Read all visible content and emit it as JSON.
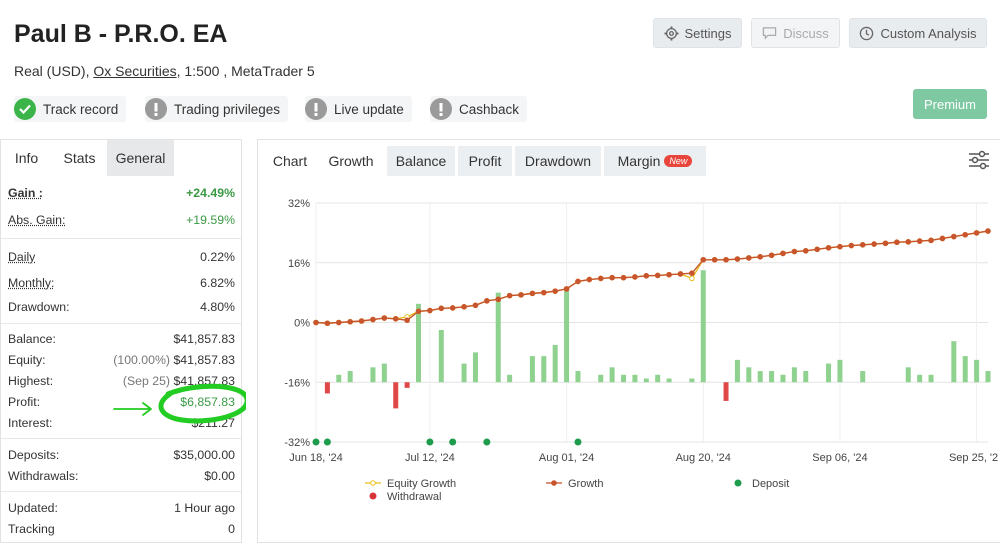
{
  "header": {
    "title": "Paul B - P.R.O. EA",
    "account_type": "Real (USD), ",
    "broker": "Ox Securities",
    "details": ", 1:500 , MetaTrader 5",
    "buttons": {
      "settings": "Settings",
      "discuss": "Discuss",
      "custom_analysis": "Custom Analysis",
      "premium": "Premium"
    }
  },
  "badges": [
    {
      "label": "Track record",
      "status": "verified"
    },
    {
      "label": "Trading privileges",
      "status": "unverified"
    },
    {
      "label": "Live update",
      "status": "unverified"
    },
    {
      "label": "Cashback",
      "status": "unverified"
    }
  ],
  "left_tabs": [
    "Info",
    "Stats",
    "General"
  ],
  "stats": {
    "gain": {
      "label": "Gain :",
      "value": "+24.49%"
    },
    "abs_gain": {
      "label": "Abs. Gain:",
      "value": "+19.59%"
    },
    "daily": {
      "label": "Daily",
      "value": "0.22%"
    },
    "monthly": {
      "label": "Monthly:",
      "value": "6.82%"
    },
    "drawdown": {
      "label": "Drawdown:",
      "value": "4.80%"
    },
    "balance": {
      "label": "Balance:",
      "value": "$41,857.83"
    },
    "equity": {
      "label": "Equity:",
      "sub": "(100.00%)",
      "value": "$41,857.83"
    },
    "highest": {
      "label": "Highest:",
      "sub": "(Sep 25)",
      "value": "$41,857.83"
    },
    "profit": {
      "label": "Profit:",
      "value": "$6,857.83"
    },
    "interest": {
      "label": "Interest:",
      "value": "$211.27"
    },
    "deposits": {
      "label": "Deposits:",
      "value": "$35,000.00"
    },
    "withdrawals": {
      "label": "Withdrawals:",
      "value": "$0.00"
    },
    "updated": {
      "label": "Updated:",
      "value": "1 Hour ago"
    },
    "tracking": {
      "label": "Tracking",
      "value": "0"
    }
  },
  "chart_tabs": {
    "chart": "Chart",
    "growth": "Growth",
    "balance": "Balance",
    "profit": "Profit",
    "drawdown": "Drawdown",
    "margin": "Margin",
    "new_badge": "New"
  },
  "colors": {
    "growth_line": "#c8552e",
    "equity_line": "#e8c020",
    "bar_positive": "#8fd18f",
    "bar_negative": "#e04848",
    "deposit": "#1e9c4c",
    "withdrawal": "#d9333a",
    "highlight": "#22cc22"
  },
  "chart_data": {
    "type": "line",
    "y_ticks": [
      "32%",
      "16%",
      "0%",
      "-16%",
      "-32%"
    ],
    "ylim": [
      -32,
      32
    ],
    "x_ticks": [
      "Jun 18, '24",
      "Jul 12, '24",
      "Aug 01, '24",
      "Aug 20, '24",
      "Sep 06, '24",
      "Sep 25, '24"
    ],
    "x_tick_index": [
      0,
      10,
      22,
      34,
      46,
      58
    ],
    "grid": true,
    "legend": [
      "Equity Growth",
      "Growth",
      "Deposit",
      "Withdrawal"
    ],
    "legend_position": "bottom",
    "series": [
      {
        "name": "Growth",
        "values": [
          0,
          -0.2,
          0,
          0.2,
          0.4,
          0.8,
          1.2,
          1,
          0.6,
          3,
          3.2,
          3.8,
          3.9,
          4.2,
          4.6,
          5.8,
          6.2,
          7.2,
          7.4,
          7.8,
          8,
          8.4,
          9,
          11,
          11.5,
          11.8,
          12,
          12,
          12.2,
          12.5,
          12.6,
          12.8,
          13,
          13.2,
          16.8,
          16.8,
          16.8,
          17,
          17.3,
          17.6,
          18,
          18.5,
          19,
          19.2,
          19.6,
          20,
          20.3,
          20.6,
          20.8,
          21,
          21.2,
          21.5,
          21.6,
          21.8,
          22,
          22.5,
          23,
          23.5,
          24,
          24.49
        ]
      },
      {
        "name": "Equity Growth",
        "values": [
          0,
          -0.2,
          0,
          0.2,
          0.4,
          0.8,
          1.2,
          1,
          1.5,
          3,
          3.2,
          3.8,
          3.9,
          4.2,
          4.6,
          5.8,
          6.2,
          7.2,
          7.4,
          7.8,
          8,
          8.4,
          9,
          11,
          11.5,
          11.8,
          12,
          12,
          12.2,
          12.5,
          12.6,
          12.8,
          13,
          11.8,
          16.8,
          16.8,
          16.8,
          17,
          17.3,
          17.6,
          18,
          18.5,
          19,
          19.2,
          19.6,
          20,
          20.3,
          20.6,
          20.8,
          21,
          21.2,
          21.5,
          21.6,
          21.8,
          22,
          22.5,
          23,
          23.5,
          24,
          24.49
        ]
      },
      {
        "name": "Profit bars",
        "values": [
          0,
          -3,
          2,
          3,
          0,
          4,
          5,
          -7,
          -1.5,
          21,
          0,
          14,
          0,
          5,
          8,
          0,
          24,
          2,
          0,
          7,
          7,
          10,
          25,
          3,
          0,
          2,
          4,
          2,
          2,
          1,
          2,
          1,
          0,
          1,
          30,
          0,
          -5,
          6,
          4,
          3,
          3,
          2,
          4,
          3,
          0,
          5,
          6,
          0,
          3,
          0,
          0,
          0,
          4,
          2,
          2,
          0,
          11,
          7,
          6,
          3
        ]
      }
    ],
    "deposit_index": [
      0,
      1,
      10,
      12,
      15,
      23
    ]
  }
}
